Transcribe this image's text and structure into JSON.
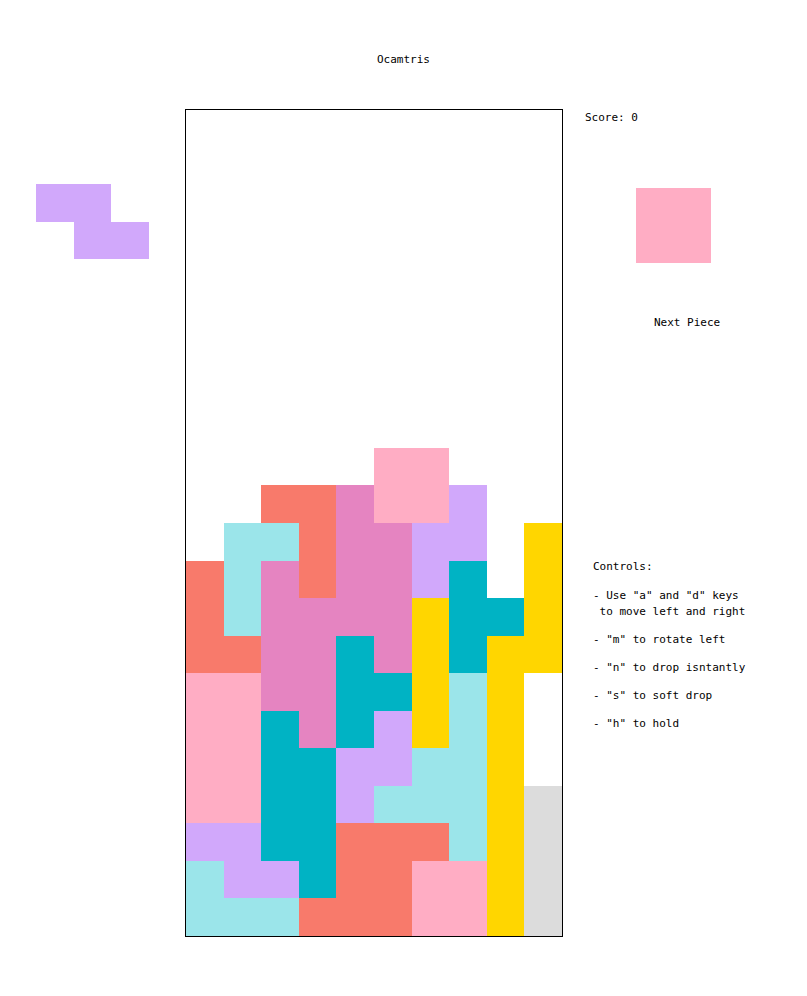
{
  "window": {
    "title": "Ocamtris"
  },
  "score": {
    "label": "Score: 0"
  },
  "hold": {
    "color": "#d1a8fb",
    "cells": [
      [
        true,
        true,
        false
      ],
      [
        false,
        true,
        true
      ]
    ]
  },
  "next": {
    "label": "Next Piece",
    "color": "#ffadc4",
    "cells": [
      [
        true,
        true
      ],
      [
        true,
        true
      ]
    ]
  },
  "controls": {
    "title": "Controls:",
    "items": [
      "- Use \"a\" and \"d\" keys\n to move left and right",
      "- \"m\" to rotate left",
      "- \"n\" to drop isntantly",
      "- \"s\" to soft drop",
      "- \"h\" to hold"
    ]
  },
  "board": {
    "rows": [
      [
        null,
        null,
        null,
        null,
        null,
        null,
        null,
        null,
        null,
        null
      ],
      [
        null,
        null,
        null,
        null,
        null,
        null,
        null,
        null,
        null,
        null
      ],
      [
        null,
        null,
        null,
        null,
        null,
        null,
        null,
        null,
        null,
        null
      ],
      [
        null,
        null,
        null,
        null,
        null,
        null,
        null,
        null,
        null,
        null
      ],
      [
        null,
        null,
        null,
        null,
        null,
        null,
        null,
        null,
        null,
        null
      ],
      [
        null,
        null,
        null,
        null,
        null,
        null,
        null,
        null,
        null,
        null
      ],
      [
        null,
        null,
        null,
        null,
        null,
        null,
        null,
        null,
        null,
        null
      ],
      [
        null,
        null,
        null,
        null,
        null,
        null,
        null,
        null,
        null,
        null
      ],
      [
        null,
        null,
        null,
        null,
        null,
        null,
        null,
        null,
        null,
        null
      ],
      [
        null,
        null,
        null,
        null,
        null,
        "#ffadc4",
        "#ffadc4",
        null,
        null,
        null
      ],
      [
        null,
        null,
        "#f87a6b",
        "#f87a6b",
        "#e584c1",
        "#ffadc4",
        "#ffadc4",
        "#d1a8fb",
        null,
        null
      ],
      [
        null,
        "#9be5ea",
        "#9be5ea",
        "#f87a6b",
        "#e584c1",
        "#e584c1",
        "#d1a8fb",
        "#d1a8fb",
        null,
        "#ffd600"
      ],
      [
        "#f87a6b",
        "#9be5ea",
        "#e584c1",
        "#f87a6b",
        "#e584c1",
        "#e584c1",
        "#d1a8fb",
        "#00b3c4",
        null,
        "#ffd600"
      ],
      [
        "#f87a6b",
        "#9be5ea",
        "#e584c1",
        "#e584c1",
        "#e584c1",
        "#e584c1",
        "#ffd600",
        "#00b3c4",
        "#00b3c4",
        "#ffd600"
      ],
      [
        "#f87a6b",
        "#f87a6b",
        "#e584c1",
        "#e584c1",
        "#00b3c4",
        "#e584c1",
        "#ffd600",
        "#00b3c4",
        "#ffd600",
        "#ffd600"
      ],
      [
        "#ffadc4",
        "#ffadc4",
        "#e584c1",
        "#e584c1",
        "#00b3c4",
        "#00b3c4",
        "#ffd600",
        "#9be5ea",
        "#ffd600",
        null
      ],
      [
        "#ffadc4",
        "#ffadc4",
        "#00b3c4",
        "#e584c1",
        "#00b3c4",
        "#d1a8fb",
        "#ffd600",
        "#9be5ea",
        "#ffd600",
        null
      ],
      [
        "#ffadc4",
        "#ffadc4",
        "#00b3c4",
        "#00b3c4",
        "#d1a8fb",
        "#d1a8fb",
        "#9be5ea",
        "#9be5ea",
        "#ffd600",
        null
      ],
      [
        "#ffadc4",
        "#ffadc4",
        "#00b3c4",
        "#00b3c4",
        "#d1a8fb",
        "#9be5ea",
        "#9be5ea",
        "#9be5ea",
        "#ffd600",
        "#dcdcdc"
      ],
      [
        "#d1a8fb",
        "#d1a8fb",
        "#00b3c4",
        "#00b3c4",
        "#f87a6b",
        "#f87a6b",
        "#f87a6b",
        "#9be5ea",
        "#ffd600",
        "#dcdcdc"
      ],
      [
        "#9be5ea",
        "#d1a8fb",
        "#d1a8fb",
        "#00b3c4",
        "#f87a6b",
        "#f87a6b",
        "#ffadc4",
        "#ffadc4",
        "#ffd600",
        "#dcdcdc"
      ],
      [
        "#9be5ea",
        "#9be5ea",
        "#9be5ea",
        "#f87a6b",
        "#f87a6b",
        "#f87a6b",
        "#ffadc4",
        "#ffadc4",
        "#ffd600",
        "#dcdcdc"
      ]
    ]
  }
}
